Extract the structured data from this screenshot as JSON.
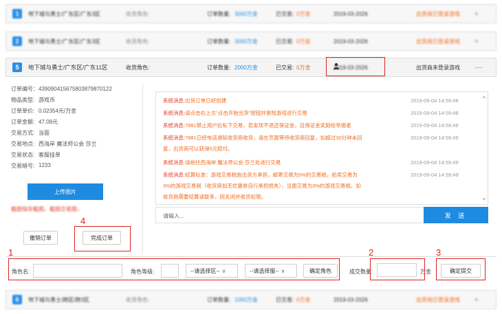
{
  "rows_top": [
    {
      "num": "1",
      "title": "地下城与勇士/广东区/广东3区",
      "role": "收货角色:",
      "count_label": "订单数量:",
      "count_value": "3000万金",
      "traded_label": "已交易:",
      "traded_value": "0万金",
      "date": "2019-03-2026",
      "status": "出货商已登录游戏",
      "plus": "+"
    },
    {
      "num": "2",
      "title": "地下城与勇士/广东区/广东3区",
      "role": "收货角色:",
      "count_label": "订单数量:",
      "count_value": "3000万金",
      "traded_label": "已交易:",
      "traded_value": "0万金",
      "date": "2019-03-2026",
      "status": "出货商已登录游戏",
      "plus": "+"
    }
  ],
  "active_row": {
    "num": "5",
    "title": "地下城与勇士/广东区/广东11区",
    "role_label": "收货角色:",
    "count_label": "订单数量:",
    "count_value": "2000万金",
    "traded_label": "已交易:",
    "traded_value": "0万金",
    "date": "2019-03-2026",
    "status": "出货商未登录游戏",
    "collapse": "—"
  },
  "order": {
    "order_no": "订单编号：4390904156758038798701​22",
    "item_type_label": "物品类型:",
    "item_type": "游戏币",
    "unit_price_label": "订单单价:",
    "unit_price": "0.02354元/万金",
    "amount_label": "订单金额:",
    "amount": "47.08元",
    "method_label": "交易方式:",
    "method": "当面",
    "place_label": "交易地点:",
    "place": "西海岸 魔法师公会 莎兰",
    "state_label": "交易状态:",
    "state": "客服挂单",
    "code_label": "交易暗号:",
    "code": "1233",
    "upload_button": "上传图片",
    "note": "截图保存截图，截图交易图，  ",
    "cancel_button": "撤销订单",
    "complete_button": "完成订单"
  },
  "messages": [
    {
      "prefix": "系统消息:",
      "text": "出货订单已经创建",
      "time": "2019-09-04 14:59:48"
    },
    {
      "prefix": "系统消息:",
      "text": "请点击右上方\"点击开始出货\"按钮并登陆游戏进行交易",
      "time": "2019-09-04 14:59:48"
    },
    {
      "prefix": "系统消息:",
      "text": "7881禁止用户拉私下交易，若发现不退还保证金，且保证金奖励给举报者",
      "time": "2019-09-04 14:59:48"
    },
    {
      "prefix": "系统消息:",
      "text": "7881已经电话通知收货商收货，请在页面等待收货商回复，如超过30分钟未回",
      "time": "2019-09-04 14:59:49",
      "cont": "复，出货商可以获得5元赔付。"
    },
    {
      "prefix": "系统消息:",
      "text": "请前往西海岸 魔法师公会 莎兰处进行交易",
      "time": "2019-09-04 14:59:49"
    },
    {
      "prefix": "系统消息:",
      "text": "结算标准：游戏交易税由出货方承担，邮寄交易为5%的交易税，拍卖交易为",
      "time": "2019-09-04 14:59:49",
      "cont": "3%的游戏交易税（收货商如无优惠券自行承担损失），当面交易为3%的游戏交易税。如",
      "cont2": "收货商需要结算请联系，则关闭并收货权限。"
    }
  ],
  "input_placeholder": "请输入...",
  "send_button": "发 送",
  "bottom": {
    "role_name_label": "角色名:",
    "role_level_label": "角色等级:",
    "region_select": "--请选择区--",
    "server_select": "--请选择服--",
    "confirm_role": "确定角色",
    "deal_count_label": "成交数量:",
    "unit": "万金",
    "confirm_submit": "确定提交"
  },
  "row_bottom": {
    "num": "6",
    "title": "地下城与勇士/跨区/跨3区",
    "role": "收货角色:",
    "count_label": "订单数量:",
    "count_value": "1000万金",
    "traded_label": "已交易:",
    "traded_value": "0万金",
    "date": "2019-03-2026",
    "status": "出货商已登录游戏",
    "plus": "+"
  },
  "annotations": {
    "n1": "1",
    "n2": "2",
    "n3": "3",
    "n4": "4"
  },
  "colors": {
    "accent": "#1f8be0",
    "warning": "#f26a1a",
    "annotation": "#e02020"
  }
}
